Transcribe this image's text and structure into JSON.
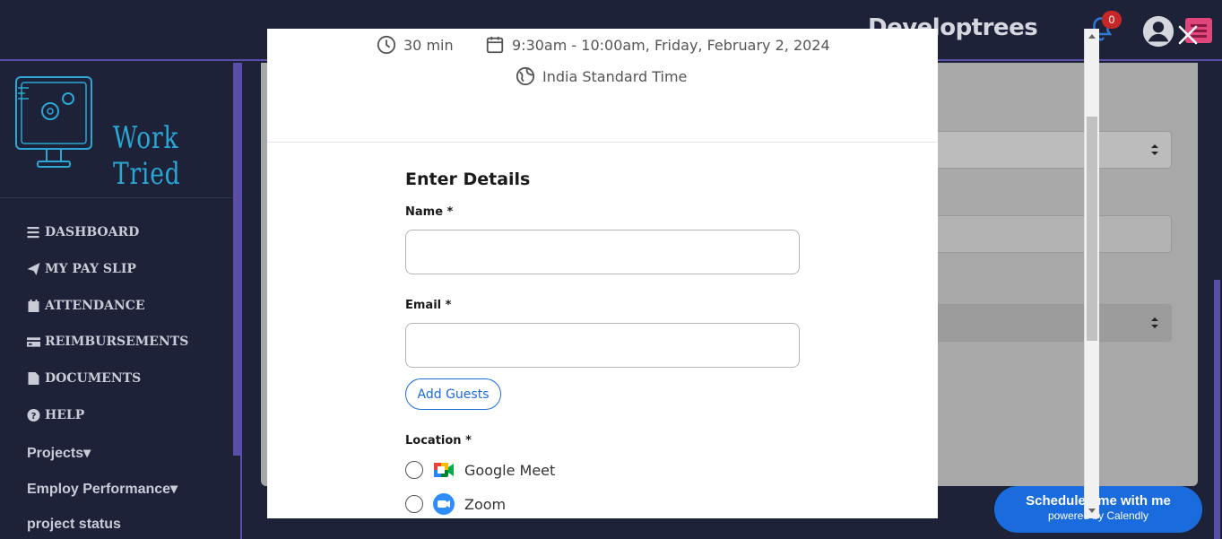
{
  "header": {
    "brand": "Developtrees",
    "notification_count": "0"
  },
  "sidebar": {
    "logo_text": "Work Tried",
    "items": [
      {
        "label": "DASHBOARD",
        "icon": "bars-icon"
      },
      {
        "label": "MY PAY SLIP",
        "icon": "paper-plane-icon"
      },
      {
        "label": "ATTENDANCE",
        "icon": "calendar-icon"
      },
      {
        "label": "REIMBURSEMENTS",
        "icon": "credit-card-icon"
      },
      {
        "label": "DOCUMENTS",
        "icon": "file-icon"
      },
      {
        "label": "HELP",
        "icon": "question-circle-icon"
      },
      {
        "label": "Projects▾",
        "icon": ""
      },
      {
        "label": "Employ Performance▾",
        "icon": ""
      },
      {
        "label": "project status",
        "icon": ""
      }
    ]
  },
  "calendly_badge": {
    "title": "Schedule time with me",
    "subtitle": "powered by Calendly"
  },
  "modal": {
    "duration": "30 min",
    "datetime": "9:30am - 10:00am, Friday, February 2, 2024",
    "timezone": "India Standard Time",
    "form_title": "Enter Details",
    "name_label": "Name *",
    "name_value": "",
    "email_label": "Email *",
    "email_value": "",
    "add_guests_label": "Add Guests",
    "location_label": "Location *",
    "locations": [
      {
        "label": "Google Meet",
        "icon": "google-meet-icon"
      },
      {
        "label": "Zoom",
        "icon": "zoom-icon"
      }
    ]
  },
  "colors": {
    "app_bg": "#1e2238",
    "accent_purple": "#5a4fa8",
    "calendly_blue": "#1a6bdd",
    "badge_red": "#c62828",
    "logo_blue": "#2aa7d4"
  }
}
